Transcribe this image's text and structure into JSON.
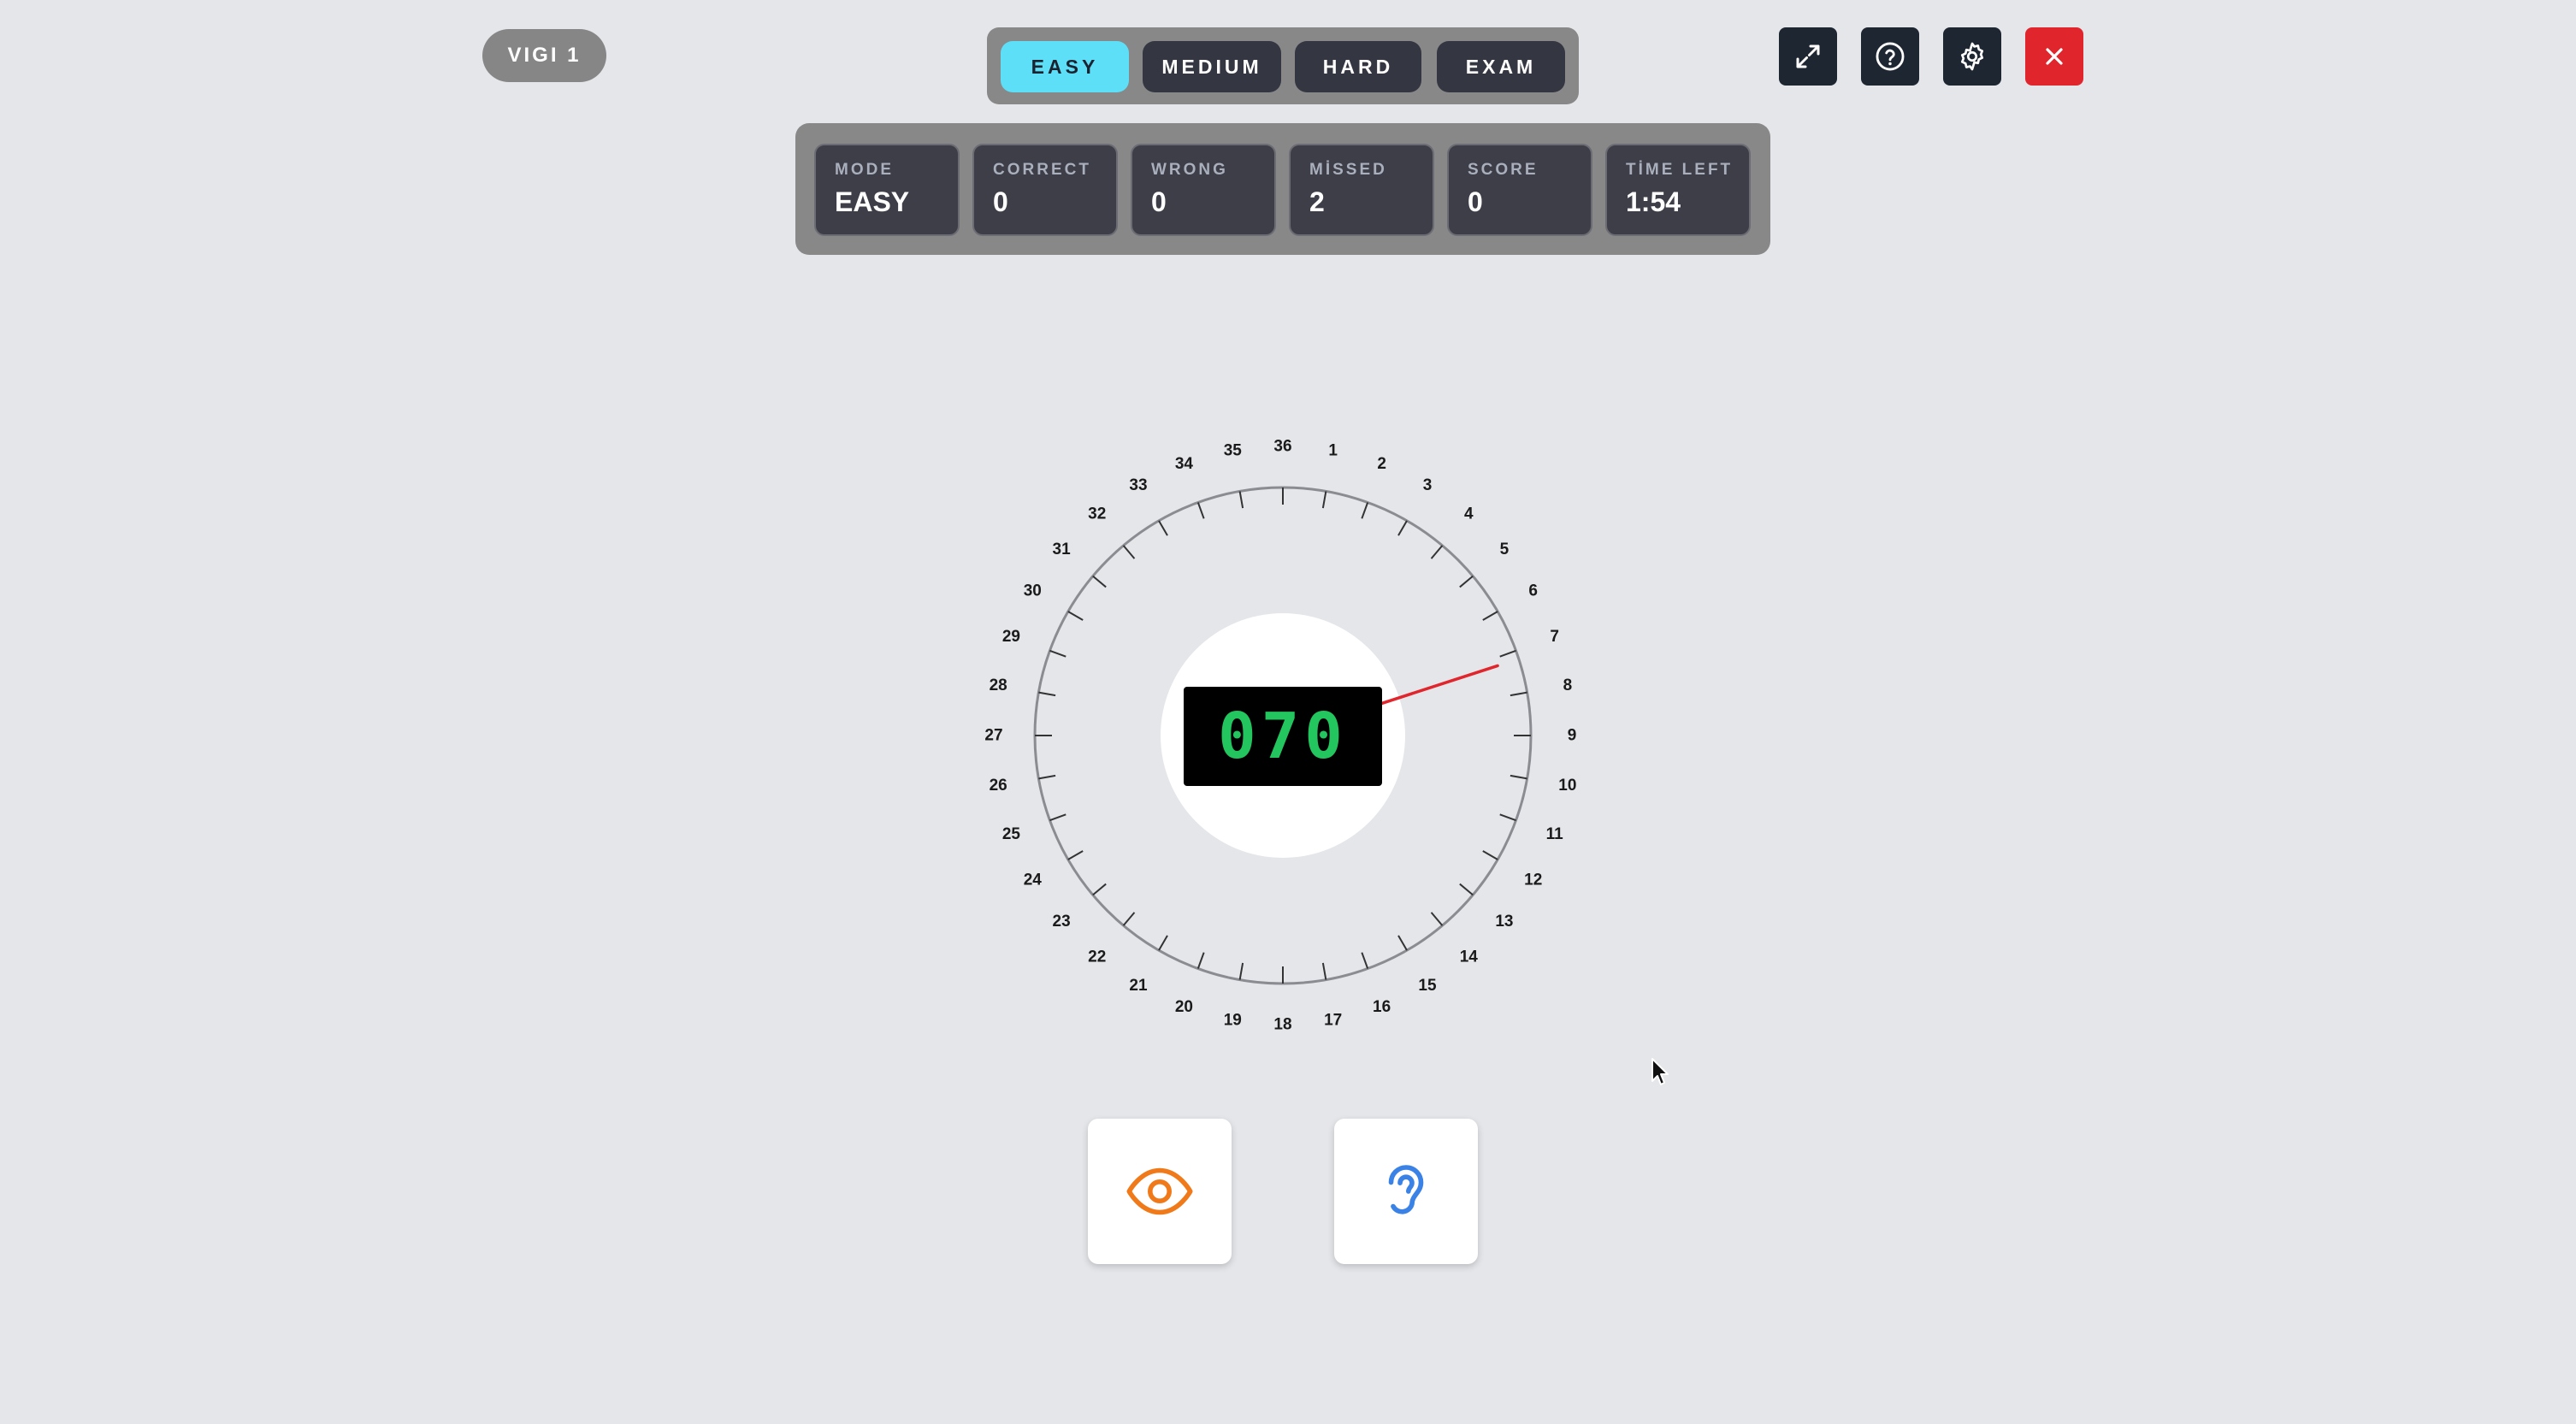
{
  "header": {
    "title": "VIGI 1",
    "levels": [
      {
        "label": "EASY",
        "active": true
      },
      {
        "label": "MEDIUM",
        "active": false
      },
      {
        "label": "HARD",
        "active": false
      },
      {
        "label": "EXAM",
        "active": false
      }
    ],
    "icons": [
      "expand-icon",
      "help-icon",
      "gear-icon",
      "close-icon"
    ]
  },
  "stats": [
    {
      "label": "MODE",
      "value": "EASY"
    },
    {
      "label": "CORRECT",
      "value": "0"
    },
    {
      "label": "WRONG",
      "value": "0"
    },
    {
      "label": "MİSSED",
      "value": "2"
    },
    {
      "label": "SCORE",
      "value": "0"
    },
    {
      "label": "TİME LEFT",
      "value": "1:54"
    }
  ],
  "dial": {
    "labels": [
      "36",
      "1",
      "2",
      "3",
      "4",
      "5",
      "6",
      "7",
      "8",
      "9",
      "10",
      "11",
      "12",
      "13",
      "14",
      "15",
      "16",
      "17",
      "18",
      "19",
      "20",
      "21",
      "22",
      "23",
      "24",
      "25",
      "26",
      "27",
      "28",
      "29",
      "30",
      "31",
      "32",
      "33",
      "34",
      "35"
    ],
    "needle_heading": 72,
    "display": "070"
  },
  "controls": {
    "visual_icon": "eye-icon",
    "audio_icon": "ear-icon"
  },
  "colors": {
    "accent": "#5ddff7",
    "needle": "#e0262c",
    "display_digits": "#22c55e",
    "eye": "#f07a1a",
    "ear": "#3b82e6"
  }
}
